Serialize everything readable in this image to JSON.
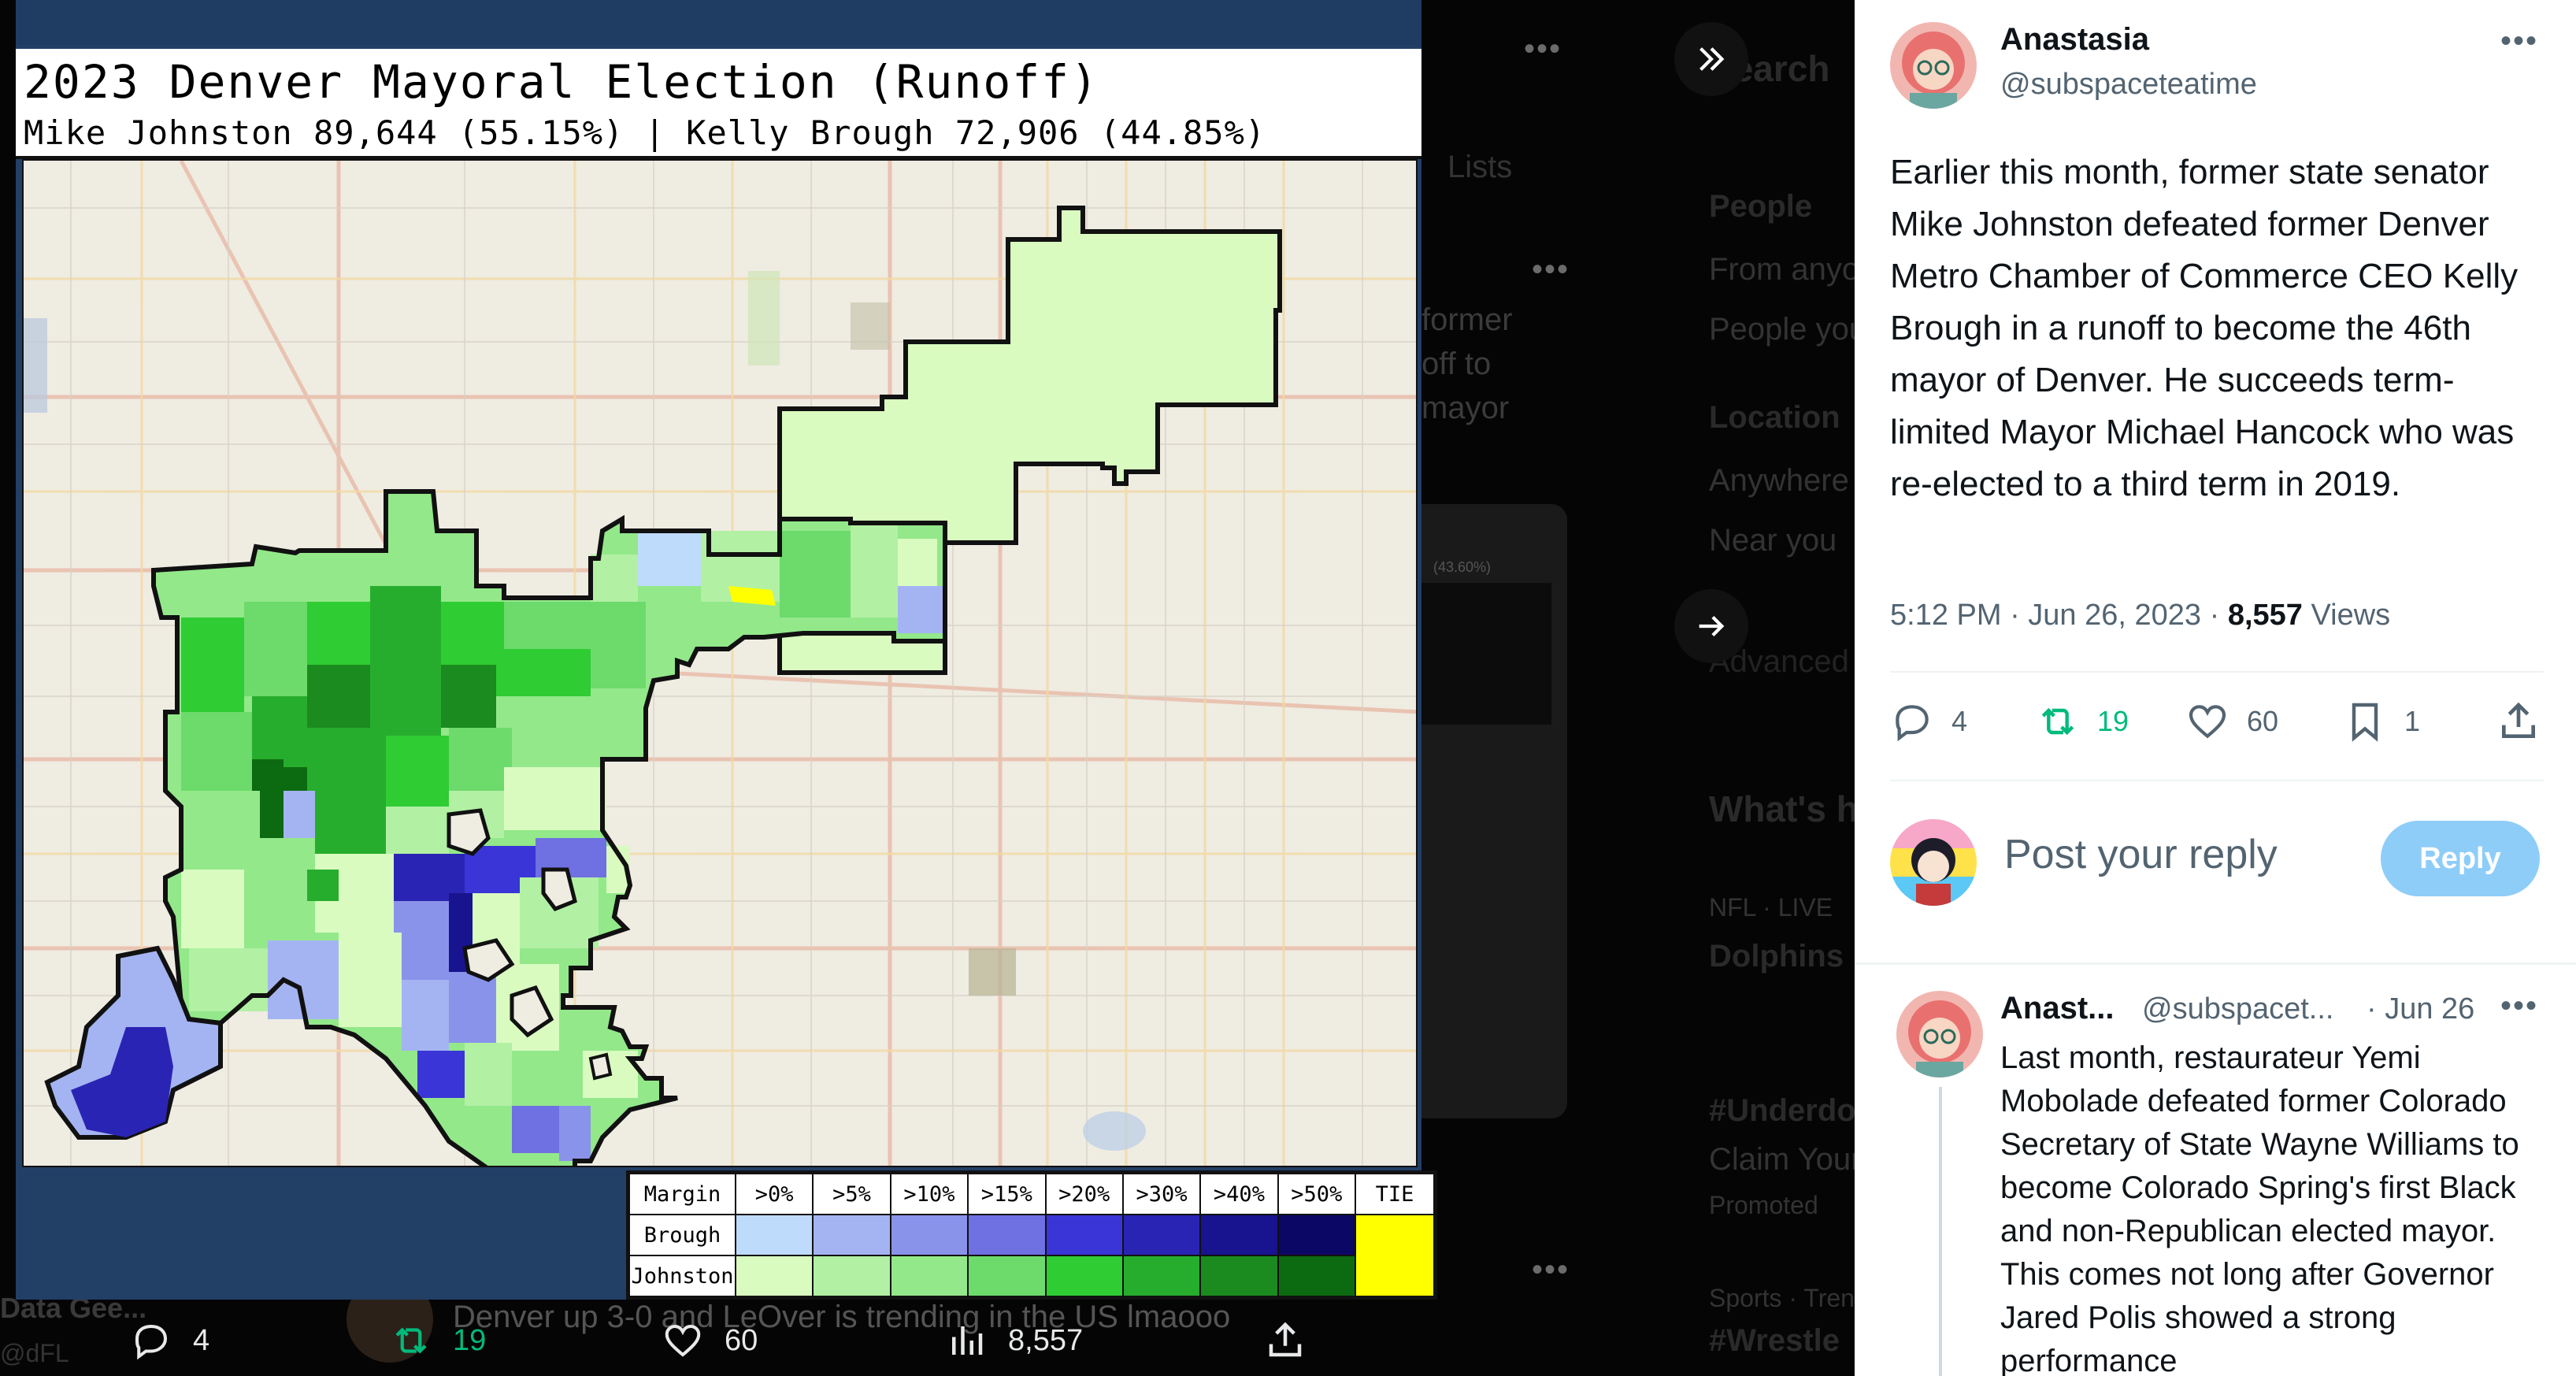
{
  "background_page": {
    "search_hint": "Search",
    "people_heading": "People",
    "people_opt1": "From anyone",
    "people_opt2": "People you follow",
    "location_heading": "Location",
    "location_opt1": "Anywhere",
    "location_opt2": "Near you",
    "advanced": "Advanced search",
    "whats": "What's happening",
    "nfl": "NFL · LIVE",
    "dolphins": "Dolphins",
    "underdog": "#Underdog",
    "claim": "Claim Your",
    "promoted": "Promoted",
    "sports": "Sports · Trending",
    "wrestle": "#Wrestle",
    "lists": "Lists",
    "former": "former",
    "off_to": "off to",
    "mayor": "mayor",
    "data_gee": "Data Gee...",
    "data_handle": "@dFL",
    "partial_tweet": "Denver up 3-0 and LeOver is trending in the US lmaooo",
    "percent_snippet": "(43.60%)"
  },
  "map": {
    "title": "2023 Denver Mayoral Election (Runoff)",
    "subtitle": "Mike Johnston 89,644 (55.15%) | Kelly Brough 72,906 (44.85%)",
    "legend": {
      "header_label": "Margin",
      "columns": [
        ">0%",
        ">5%",
        ">10%",
        ">15%",
        ">20%",
        ">30%",
        ">40%",
        ">50%"
      ],
      "tie_label": "TIE",
      "rows": [
        {
          "label": "Brough",
          "colors": [
            "#bfdbfb",
            "#a4b4f2",
            "#8a93ea",
            "#6f70e2",
            "#3a35d6",
            "#2a24b4",
            "#18138e",
            "#0b0764"
          ]
        },
        {
          "label": "Johnston",
          "colors": [
            "#d9fbc0",
            "#b2f0a4",
            "#93e88a",
            "#6dda6c",
            "#2fcc34",
            "#27ad2d",
            "#1b8a1f",
            "#0c6a10"
          ]
        }
      ],
      "tie_color": "#ffff00"
    }
  },
  "viewer_bar": {
    "replies": "4",
    "retweets": "19",
    "likes": "60",
    "views": "8,557"
  },
  "tweet": {
    "author_name": "Anastasia",
    "author_handle": "@subspaceteatime",
    "text": "Earlier this month, former state senator Mike Johnston defeated former Denver Metro Chamber of Commerce CEO Kelly Brough in a runoff to become the 46th mayor of Denver. He succeeds term-limited Mayor Michael Hancock who was re-elected to a third term in 2019.",
    "time": "5:12 PM · Jun 26, 2023 · ",
    "views_count": "8,557",
    "views_label": " Views",
    "replies": "4",
    "retweets": "19",
    "likes": "60",
    "bookmarks": "1",
    "reply_placeholder": "Post your reply",
    "reply_button": "Reply"
  },
  "reply_tweet": {
    "author_name": "Anast...",
    "author_handle": "@subspacet...",
    "date": "· Jun 26",
    "text": "Last month, restaurateur Yemi Mobolade defeated former Colorado Secretary of State Wayne Williams to become Colorado Spring's first Black and non-Republican elected mayor. This comes not long after Governor Jared Polis showed a strong performance"
  }
}
